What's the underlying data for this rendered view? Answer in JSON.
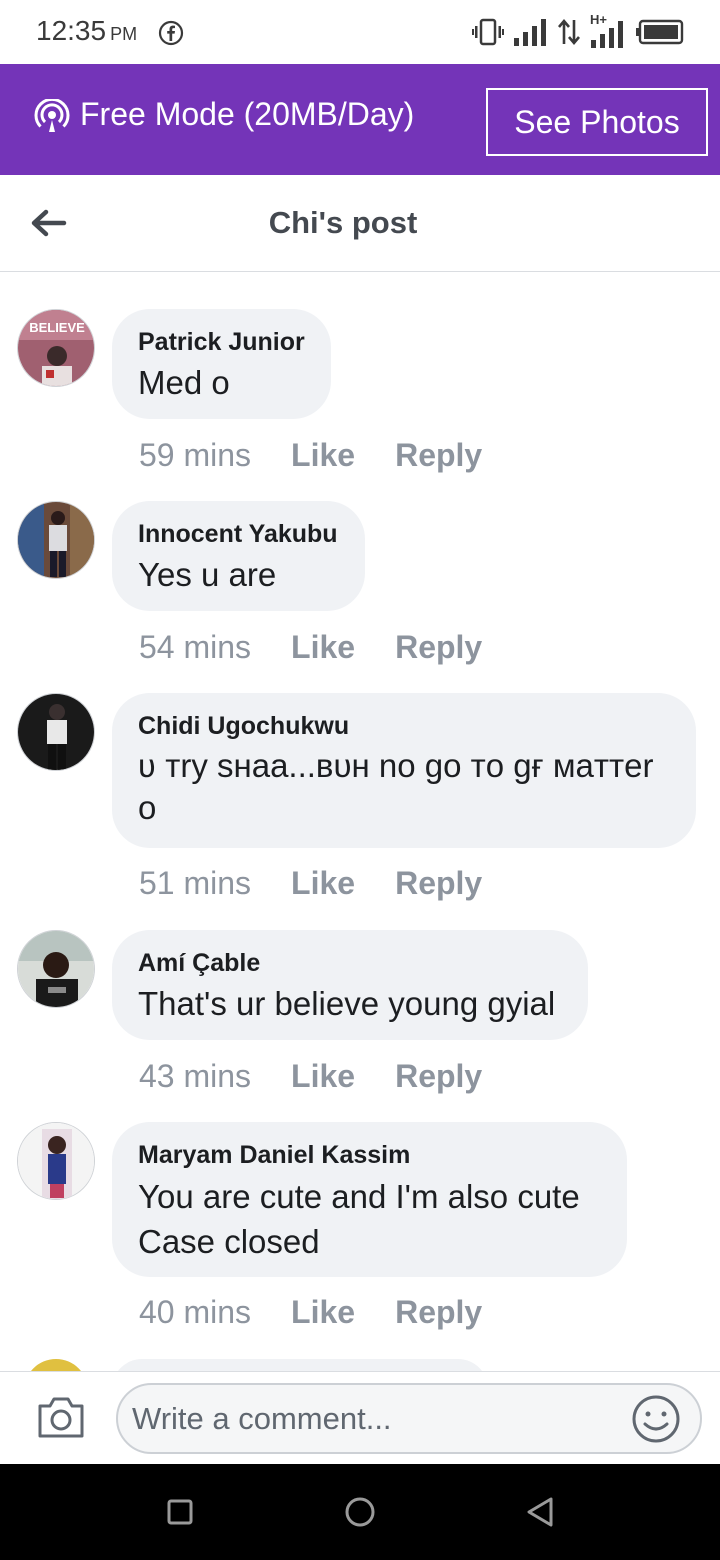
{
  "status_bar": {
    "time": "12:35",
    "ampm": "PM",
    "network_label": "H+",
    "icons": [
      "facebook-icon",
      "vibrate-icon",
      "signal-icon",
      "data-transfer-icon",
      "signal-hplus-icon",
      "battery-icon"
    ]
  },
  "banner": {
    "text": "Free Mode (20MB/Day)",
    "button_label": "See Photos",
    "background": "#7434b8"
  },
  "header": {
    "title": "Chi's post"
  },
  "comments": [
    {
      "author": "Patrick Junior",
      "text": "Med o",
      "time": "59 mins",
      "like": "Like",
      "reply": "Reply",
      "avatar_label": "BELIEVE"
    },
    {
      "author": "Innocent Yakubu",
      "text": "Yes u are",
      "time": "54 mins",
      "like": "Like",
      "reply": "Reply"
    },
    {
      "author": "Chidi Ugochukwu",
      "text_line1": "ʋ тry sнaa...вυн no go тo gғ мaттer",
      "text_line2": "o",
      "time": "51 mins",
      "like": "Like",
      "reply": "Reply"
    },
    {
      "author": "Amí Çable",
      "text": "That's ur believe young gyial",
      "time": "43 mins",
      "like": "Like",
      "reply": "Reply"
    },
    {
      "author": "Maryam Daniel Kassim",
      "text_line1": "You are cute and I'm also cute",
      "text_line2": "Case closed",
      "time": "40 mins",
      "like": "Like",
      "reply": "Reply"
    }
  ],
  "compose": {
    "placeholder": "Write a comment..."
  },
  "colors": {
    "accent": "#7434b8",
    "bubble": "#f0f2f5",
    "meta": "#8d949e"
  }
}
